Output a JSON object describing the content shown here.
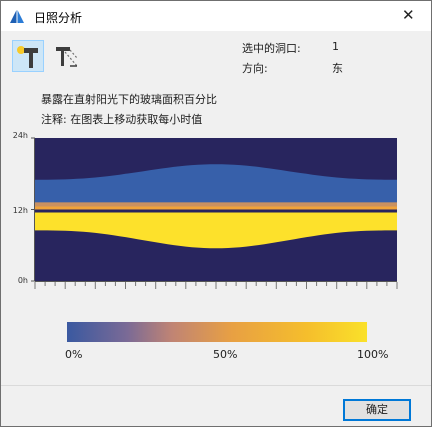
{
  "window": {
    "title": "日照分析"
  },
  "toolbar": {
    "selected_opening_label": "选中的洞口:",
    "selected_opening_value": "1",
    "direction_label": "方向:",
    "direction_value": "东"
  },
  "description": {
    "line1": "暴露在直射阳光下的玻璃面积百分比",
    "line2": "注释: 在图表上移动获取每小时值"
  },
  "chart_data": {
    "type": "heatmap",
    "title": "",
    "xlabel": "",
    "ylabel": "",
    "y_ticks": [
      "24h",
      "12h",
      "0h"
    ],
    "ylim": [
      0,
      24
    ],
    "x_tick_count": 36,
    "color_scale": {
      "min_label": "0%",
      "mid_label": "50%",
      "max_label": "100%",
      "colors": [
        "#3a59a0",
        "#c08474",
        "#f5be2c",
        "#fae12a"
      ]
    },
    "background_color": "#28255e",
    "bands": [
      {
        "name": "",
        "value_pct": 0,
        "hours_lower": [
          12.5,
          12.5,
          12.5,
          12.5
        ],
        "hours_upper": [
          17.0,
          17.4,
          19.6,
          17.0
        ],
        "color": "#3760aa"
      },
      {
        "name": "",
        "value_pct": 65,
        "hours_lower": [
          12.0,
          12.0,
          12.0,
          12.0
        ],
        "hours_upper": [
          12.5,
          12.5,
          12.5,
          12.5
        ],
        "color": "#f0a33a"
      },
      {
        "name": "",
        "value_pct": 95,
        "hours_lower": [
          8.5,
          8.2,
          5.5,
          8.5
        ],
        "hours_upper": [
          11.5,
          11.5,
          11.5,
          11.5
        ],
        "color": "#fde12b"
      }
    ]
  },
  "buttons": {
    "ok": "确定"
  }
}
